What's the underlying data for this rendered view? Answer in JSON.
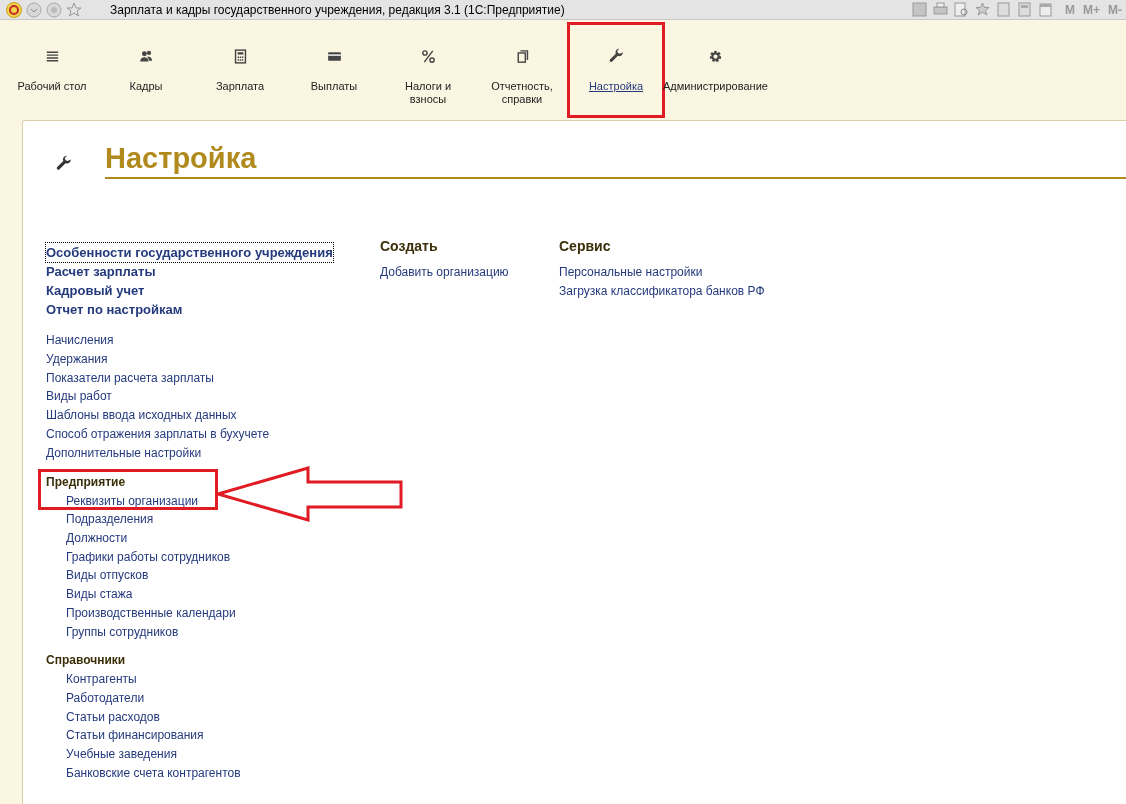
{
  "window": {
    "title": "Зарплата и кадры государственного учреждения, редакция 3.1  (1С:Предприятие)",
    "memory_buttons": [
      "M",
      "M+",
      "M-"
    ]
  },
  "sections": [
    {
      "label": "Рабочий стол",
      "kind": "list",
      "selected": false,
      "highlighted": false
    },
    {
      "label": "Кадры",
      "kind": "people",
      "selected": false,
      "highlighted": false
    },
    {
      "label": "Зарплата",
      "kind": "calculator",
      "selected": false,
      "highlighted": false
    },
    {
      "label": "Выплаты",
      "kind": "card",
      "selected": false,
      "highlighted": false
    },
    {
      "label": "Налоги и взносы",
      "kind": "percent",
      "selected": false,
      "highlighted": false
    },
    {
      "label": "Отчетность, справки",
      "kind": "documents",
      "selected": false,
      "highlighted": false
    },
    {
      "label": "Настройка",
      "kind": "wrench",
      "selected": true,
      "highlighted": true
    },
    {
      "label": "Администрирование",
      "kind": "gear",
      "selected": false,
      "highlighted": false
    }
  ],
  "page": {
    "title": "Настройка"
  },
  "main_links": [
    {
      "label": "Особенности государственного учреждения",
      "focused": true
    },
    {
      "label": "Расчет зарплаты",
      "focused": false
    },
    {
      "label": "Кадровый учет",
      "focused": false
    },
    {
      "label": "Отчет по настройкам",
      "focused": false
    }
  ],
  "links": [
    "Начисления",
    "Удержания",
    "Показатели расчета зарплаты",
    "Виды работ",
    "Шаблоны ввода исходных данных",
    "Способ отражения зарплаты в бухучете",
    "Дополнительные настройки"
  ],
  "groups": [
    {
      "title": "Предприятие",
      "items": [
        {
          "label": "Реквизиты организации",
          "highlighted": true
        },
        {
          "label": "Подразделения",
          "highlighted": false
        },
        {
          "label": "Должности",
          "highlighted": false
        },
        {
          "label": "Графики работы сотрудников",
          "highlighted": false
        },
        {
          "label": "Виды отпусков",
          "highlighted": false
        },
        {
          "label": "Виды стажа",
          "highlighted": false
        },
        {
          "label": "Производственные календари",
          "highlighted": false
        },
        {
          "label": "Группы сотрудников",
          "highlighted": false
        }
      ]
    },
    {
      "title": "Справочники",
      "items": [
        {
          "label": "Контрагенты",
          "highlighted": false
        },
        {
          "label": "Работодатели",
          "highlighted": false
        },
        {
          "label": "Статьи расходов",
          "highlighted": false
        },
        {
          "label": "Статьи финансирования",
          "highlighted": false
        },
        {
          "label": "Учебные заведения",
          "highlighted": false
        },
        {
          "label": "Банковские счета контрагентов",
          "highlighted": false
        }
      ]
    }
  ],
  "create": {
    "title": "Создать",
    "items": [
      "Добавить организацию"
    ]
  },
  "service": {
    "title": "Сервис",
    "items": [
      "Персональные настройки",
      "Загрузка классификатора банков РФ"
    ]
  }
}
